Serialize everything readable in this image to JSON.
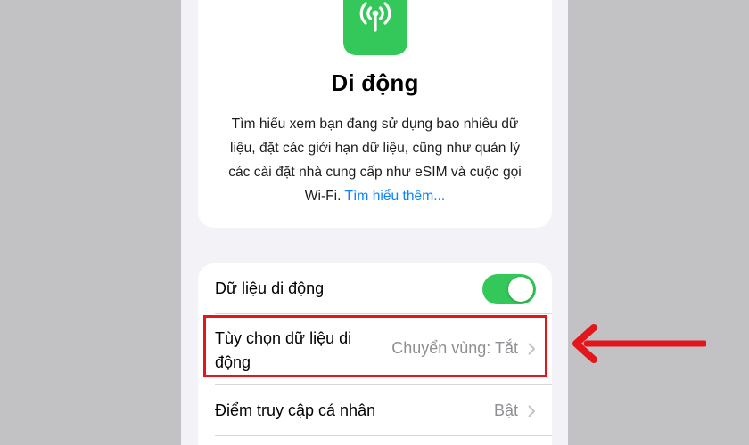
{
  "header": {
    "icon": "antenna-signal-icon",
    "title": "Di động",
    "description": "Tìm hiểu xem bạn đang sử dụng bao nhiêu dữ liệu, đặt các giới hạn dữ liệu, cũng như quản lý các cài đặt nhà cung cấp như eSIM và cuộc gọi Wi-Fi.",
    "learn_more": "Tìm hiểu thêm..."
  },
  "settings": {
    "mobile_data": {
      "label": "Dữ liệu di động",
      "toggle_on": true
    },
    "data_options": {
      "label": "Tùy chọn dữ liệu di động",
      "value": "Chuyển vùng: Tắt"
    },
    "hotspot": {
      "label": "Điểm truy cập cá nhân",
      "value": "Bật"
    }
  },
  "colors": {
    "accent_green": "#34c759",
    "link_blue": "#0a84ff",
    "annotation_red": "#e3161b"
  }
}
